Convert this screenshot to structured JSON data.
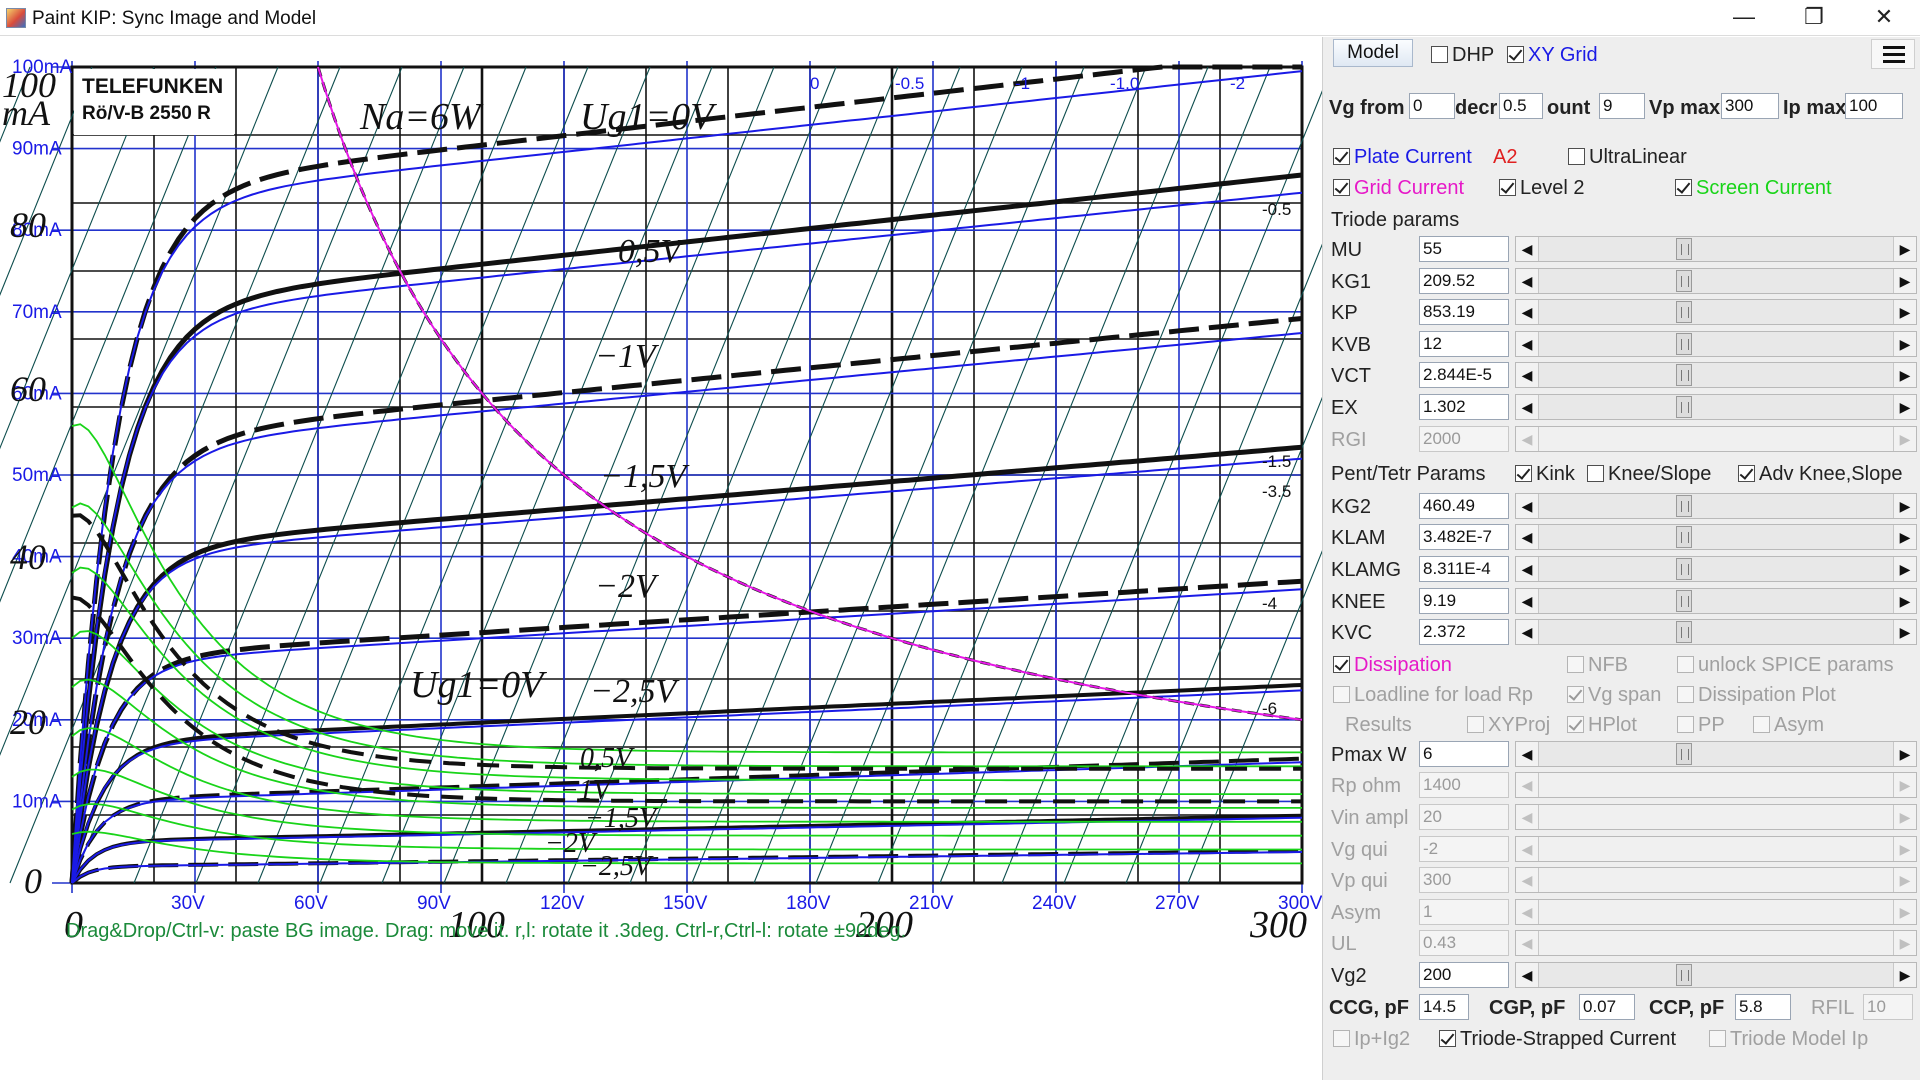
{
  "window": {
    "title": "Paint KIP: Sync Image and Model",
    "min_glyph": "—",
    "max_glyph": "❐",
    "close_glyph": "✕"
  },
  "plot": {
    "hint": "Drag&Drop/Ctrl-v: paste BG image. Drag: move it. r,l: rotate it .3deg. Ctrl-r,Ctrl-l: rotate ±90deg.",
    "y_axis_labels": [
      "100mA",
      "90mA",
      "80mA",
      "70mA",
      "60mA",
      "50mA",
      "40mA",
      "30mA",
      "20mA",
      "10mA"
    ],
    "x_axis_labels": [
      "30V",
      "60V",
      "90V",
      "120V",
      "150V",
      "180V",
      "210V",
      "240V",
      "270V",
      "300V"
    ],
    "loadline_labels": [
      "0",
      "-0.5",
      "-1",
      "-1.0",
      "-2"
    ],
    "right_edge_labels": [
      "-0.5",
      "-1.5",
      "-3.5",
      "-4",
      "-6"
    ],
    "bg_scan": {
      "brand": "TELEFUNKEN",
      "model": "Rö/V-B 2550 R",
      "power_label": "Na=6W",
      "grid0_label": "Ug1=0V",
      "grid0_label2": "Ug1=0V",
      "curve_labels": [
        "−0,5V",
        "−1V",
        "−1,5V",
        "−2V",
        "−2,5V",
        "0,5V",
        "−1V",
        "−1,5V",
        "−2V",
        "−2,5V"
      ],
      "y_big": [
        "100",
        "mA",
        "80",
        "60",
        "40",
        "20",
        "0"
      ],
      "x_big": [
        "0",
        "100",
        "200",
        "300"
      ]
    },
    "colors": {
      "model": "#1a1ae6",
      "screen": "#19d419",
      "dissipation": "#e619e6",
      "loadline": "#0d4d4d",
      "grid": "#2233cc",
      "scan": "#111111"
    }
  },
  "panel": {
    "model_button": "Model",
    "dhp": {
      "label": "DHP",
      "checked": false
    },
    "xy_grid": {
      "label": "XY Grid",
      "checked": true
    },
    "vg_from": {
      "label": "Vg from",
      "value": "0"
    },
    "decr": {
      "label": "decr",
      "value": "0.5"
    },
    "count": {
      "label": "ount",
      "value": "9"
    },
    "vp_max": {
      "label": "Vp max",
      "value": "300"
    },
    "ip_max": {
      "label": "Ip max",
      "value": "100"
    },
    "plate_current": {
      "label": "Plate Current",
      "checked": true
    },
    "a2_label": "A2",
    "ultralinear": {
      "label": "UltraLinear",
      "checked": false
    },
    "grid_current": {
      "label": "Grid Current",
      "checked": true
    },
    "level2": {
      "label": "Level 2",
      "checked": true
    },
    "screen_current": {
      "label": "Screen Current",
      "checked": true
    },
    "triode_header": "Triode params",
    "triode_params": [
      {
        "name": "MU",
        "value": "55"
      },
      {
        "name": "KG1",
        "value": "209.52"
      },
      {
        "name": "KP",
        "value": "853.19"
      },
      {
        "name": "KVB",
        "value": "12"
      },
      {
        "name": "VCT",
        "value": "2.844E-5"
      },
      {
        "name": "EX",
        "value": "1.302"
      },
      {
        "name": "RGI",
        "value": "2000"
      }
    ],
    "pent_header": "Pent/Tetr Params",
    "kink": {
      "label": "Kink",
      "checked": true
    },
    "knee_slope": {
      "label": "Knee/Slope",
      "checked": false
    },
    "adv_knee": {
      "label": "Adv Knee,Slope",
      "checked": true
    },
    "pent_params": [
      {
        "name": "KG2",
        "value": "460.49"
      },
      {
        "name": "KLAM",
        "value": "3.482E-7"
      },
      {
        "name": "KLAMG",
        "value": "8.311E-4"
      },
      {
        "name": "KNEE",
        "value": "9.19"
      },
      {
        "name": "KVC",
        "value": "2.372"
      }
    ],
    "dissipation": {
      "label": "Dissipation",
      "checked": true
    },
    "nfb": {
      "label": "NFB",
      "checked": false
    },
    "unlock_spice": {
      "label": "unlock SPICE params",
      "checked": false
    },
    "loadline": {
      "label": "Loadline for load Rp",
      "checked": false
    },
    "vg_span": {
      "label": "Vg span",
      "checked": true
    },
    "dissipation_plot": {
      "label": "Dissipation Plot",
      "checked": false
    },
    "results_label": "Results",
    "xyproj": {
      "label": "XYProj",
      "checked": false
    },
    "hplot": {
      "label": "HPlot",
      "checked": true
    },
    "pp": {
      "label": "PP",
      "checked": false
    },
    "asym_chk": {
      "label": "Asym",
      "checked": false
    },
    "load_params": [
      {
        "name": "Pmax W",
        "value": "6"
      },
      {
        "name": "Rp ohm",
        "value": "1400"
      },
      {
        "name": "Vin ampl",
        "value": "20"
      },
      {
        "name": "Vg qui",
        "value": "-2"
      },
      {
        "name": "Vp qui",
        "value": "300"
      },
      {
        "name": "Asym",
        "value": "1"
      },
      {
        "name": "UL",
        "value": "0.43"
      },
      {
        "name": "Vg2",
        "value": "200"
      }
    ],
    "ccg": {
      "label": "CCG, pF",
      "value": "14.5"
    },
    "cgp": {
      "label": "CGP, pF",
      "value": "0.07"
    },
    "ccp": {
      "label": "CCP, pF",
      "value": "5.8"
    },
    "rfil": {
      "label": "RFIL",
      "value": "10"
    },
    "ip_ig2": {
      "label": "Ip+Ig2",
      "checked": false
    },
    "triode_strapped": {
      "label": "Triode-Strapped Current",
      "checked": true
    },
    "triode_model_ip": {
      "label": "Triode Model Ip",
      "checked": false
    }
  }
}
